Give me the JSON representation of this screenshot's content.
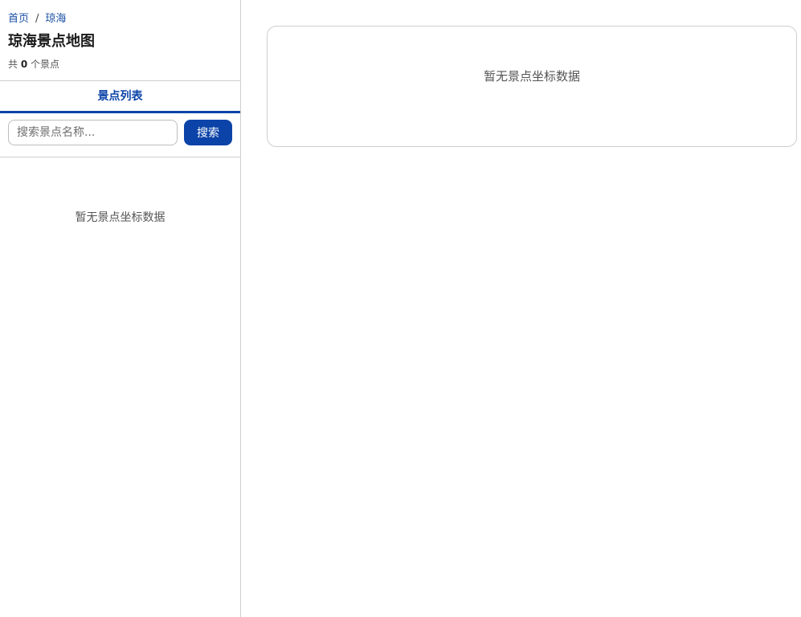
{
  "breadcrumb": {
    "home": "首页",
    "separator": "/",
    "current": "琼海"
  },
  "header": {
    "title": "琼海景点地图",
    "count_prefix": "共",
    "count": "0",
    "count_suffix": "个景点"
  },
  "tabs": [
    {
      "label": "景点列表",
      "active": true
    }
  ],
  "search": {
    "placeholder": "搜索景点名称...",
    "value": "",
    "button_label": "搜索"
  },
  "list": {
    "empty_text": "暂无景点坐标数据"
  },
  "map": {
    "empty_text": "暂无景点坐标数据"
  },
  "colors": {
    "accent": "#0b43a8",
    "border": "#cfcfcf",
    "muted_text": "#555555"
  }
}
